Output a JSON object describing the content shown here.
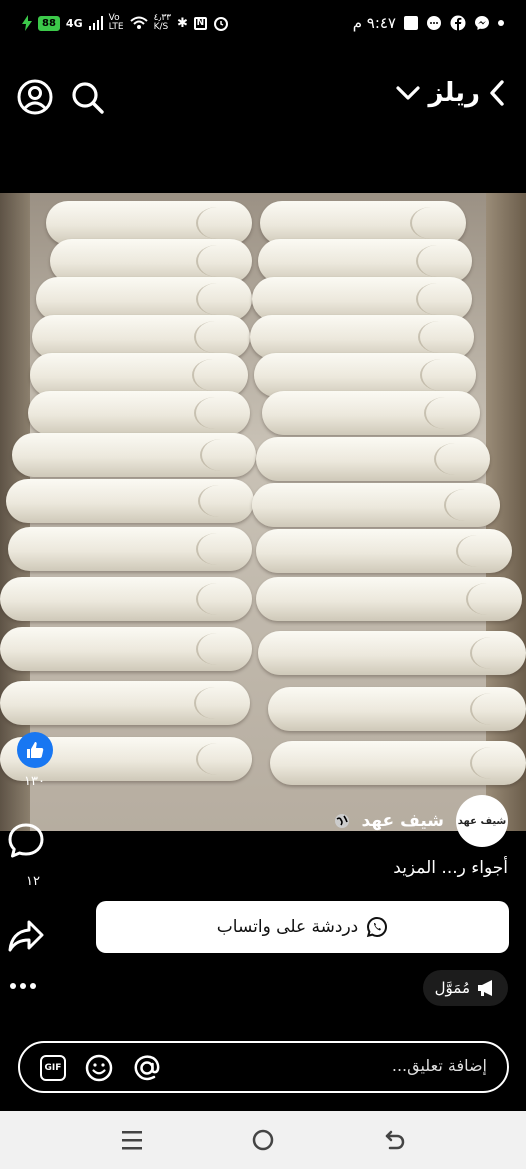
{
  "status_bar": {
    "battery": "88",
    "network": "4G",
    "volte": "Vo\nLTE",
    "speed": "٤٫٣٣\nK/S",
    "time": "٩:٤٧ م"
  },
  "header": {
    "title": "ريلز"
  },
  "video": {
    "subject": "spring rolls on tray"
  },
  "actions": {
    "likes": "١٣٠",
    "comments": "١٢"
  },
  "author": {
    "name": "شيف عهد",
    "avatar_text": "شيف عهد"
  },
  "caption": "أجواء ر... المزيد",
  "whatsapp_button": {
    "label": "دردشة على واتساب"
  },
  "sponsored": {
    "label": "مُمَوَّل"
  },
  "comment": {
    "placeholder": "إضافة تعليق..."
  },
  "colors": {
    "like_blue": "#1877f2",
    "battery_green": "#3cc94a"
  }
}
